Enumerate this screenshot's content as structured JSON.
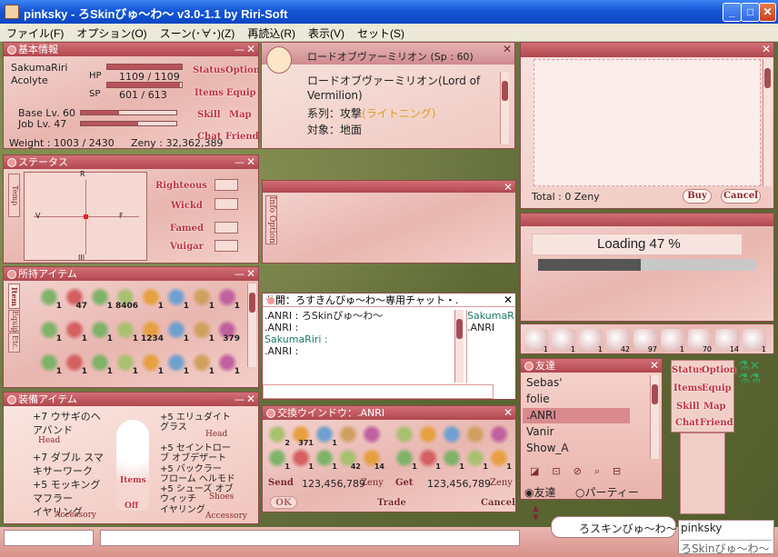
{
  "window": {
    "title": "pinksky - ろSkinびゅ～わ～ v3.0-1.1 by Riri-Soft",
    "min": "_",
    "max": "□",
    "close": "✕"
  },
  "menu": [
    "ファイル(F)",
    "オプション(O)",
    "スーン(･∀･)(Z)",
    "再読込(R)",
    "表示(V)",
    "セット(S)"
  ],
  "basic": {
    "title": "基本情報",
    "name": "SakumaRiri",
    "job": "Acolyte",
    "hp_label": "HP",
    "hp": "1109 / 1109",
    "hp_frac": 1.0,
    "sp_label": "SP",
    "sp": "601 / 613",
    "sp_frac": 0.98,
    "base": "Base Lv. 60",
    "joblv": "Job Lv. 47",
    "base_frac": 0.4,
    "job_frac": 0.6,
    "weight": "Weight : 1003 / 2430",
    "zeny": "Zeny : 32,362,389",
    "buttons": [
      "Status",
      "Option",
      "Items",
      "Equip",
      "Skill",
      "Map",
      "Chat",
      "Friend"
    ]
  },
  "skill": {
    "title": "ロードオブヴァーミリオン (Sp : 60)",
    "line1": "ロードオブヴァーミリオン(Lord of",
    "line2": "Vermilion)",
    "attr_label": "系列：攻撃",
    "attr_val": "(ライトニング)",
    "target": "対象：地面"
  },
  "shop": {
    "total": "Total : 0 Zeny",
    "buy": "Buy",
    "cancel": "Cancel"
  },
  "status": {
    "title": "ステータス",
    "tab": "Temp",
    "axes": [
      "R",
      "V",
      "F",
      "III"
    ],
    "labels": [
      "Righteous",
      "Wickd",
      "Famed",
      "Vuigar"
    ]
  },
  "info": {
    "tab": "Info",
    "tab2": "Option"
  },
  "loading": {
    "text": "Loading 47 %",
    "progress": 0.47
  },
  "inventory": {
    "title": "所持アイテム",
    "tabs": [
      "Item",
      "Equip",
      "Etc."
    ],
    "counts": [
      "1",
      "47",
      "1",
      "8406",
      "1",
      "1",
      "1",
      "1",
      "1",
      "1",
      "1",
      "1",
      "1234",
      "1",
      "1",
      "379",
      "1",
      "1",
      "1",
      "1",
      "1",
      "1",
      "1",
      "1"
    ]
  },
  "hotbar": {
    "counts": [
      "1",
      "1",
      "1",
      "42",
      "97",
      "1",
      "70",
      "14",
      "1"
    ]
  },
  "chatwin": {
    "title": "公開：ろすきんびゅ～わ～専用チャット・.",
    "lines": [
      ".ANRI : ろSkinびゅ～わ～",
      ".ANRI :",
      "SakumaRiri :",
      ".ANRI :"
    ],
    "members": [
      "SakumaRir",
      ".ANRI"
    ]
  },
  "friends": {
    "title": "友達",
    "list": [
      "Sebas'",
      "folie",
      ".ANRI",
      "Vanir",
      "Show_A"
    ],
    "selected": ".ANRI",
    "radio1": "友達",
    "radio2": "パーティー"
  },
  "mini": {
    "buttons": [
      "Status",
      "Option",
      "Items",
      "Equip",
      "Skill",
      "Map",
      "Chat",
      "Friend"
    ]
  },
  "equip": {
    "title": "装備アイテム",
    "left": [
      "+7 ウサギのヘ",
      "アバンド",
      "Head",
      "+7 ダブル スマ",
      "キサーワーク",
      "+5 モッキング",
      "マフラー",
      "イヤリング"
    ],
    "right": [
      "+5 エリュダイト",
      "グラス",
      "Head",
      "+5 セイントロー",
      "ブ オブデザート",
      "+5 バックラー",
      "フローム ヘルモド",
      "+5 シューズ オブ",
      "ウィッチ",
      "イヤリング",
      "Accessory"
    ],
    "center": [
      "Items",
      "Off"
    ],
    "acc_left": "Accessory",
    "shoes": "Shoes"
  },
  "trade": {
    "title": "交換ウインドウ：.ANRI",
    "send": "Send",
    "get": "Get",
    "send_amt": "123,456,789",
    "get_amt": "123,456,789",
    "zeny": "Zeny",
    "ok": "OK",
    "trade": "Trade",
    "cancel": "Cancel",
    "left_counts": [
      "2",
      "371",
      "1",
      "",
      "",
      "1",
      "1",
      "1",
      "42",
      "14"
    ],
    "right_counts": [
      "",
      "",
      "",
      "",
      "",
      "1",
      "1",
      "1",
      "1",
      "1"
    ]
  },
  "bubble": "ろスキンびゅ～わ～",
  "chatbox": {
    "name": "pinksky",
    "sub": "ろSkinびゅ～わ～"
  },
  "colors": {
    "title_red": "#b0474f",
    "panel": "#e9b6b0",
    "accent": "#c0313e"
  }
}
